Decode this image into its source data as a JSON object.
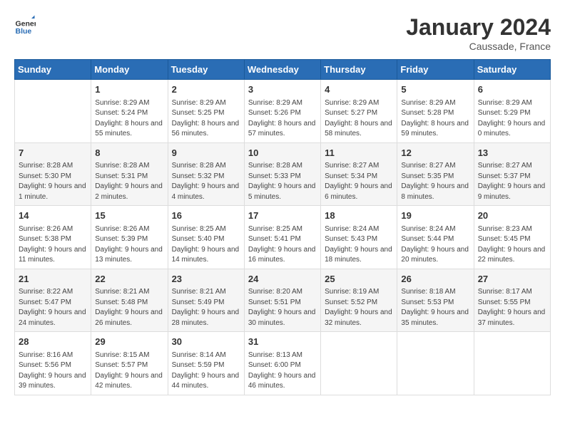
{
  "header": {
    "logo": {
      "general": "General",
      "blue": "Blue"
    },
    "title": "January 2024",
    "location": "Caussade, France"
  },
  "days_of_week": [
    "Sunday",
    "Monday",
    "Tuesday",
    "Wednesday",
    "Thursday",
    "Friday",
    "Saturday"
  ],
  "weeks": [
    [
      {
        "day": "",
        "sunrise": "",
        "sunset": "",
        "daylight": ""
      },
      {
        "day": "1",
        "sunrise": "Sunrise: 8:29 AM",
        "sunset": "Sunset: 5:24 PM",
        "daylight": "Daylight: 8 hours and 55 minutes."
      },
      {
        "day": "2",
        "sunrise": "Sunrise: 8:29 AM",
        "sunset": "Sunset: 5:25 PM",
        "daylight": "Daylight: 8 hours and 56 minutes."
      },
      {
        "day": "3",
        "sunrise": "Sunrise: 8:29 AM",
        "sunset": "Sunset: 5:26 PM",
        "daylight": "Daylight: 8 hours and 57 minutes."
      },
      {
        "day": "4",
        "sunrise": "Sunrise: 8:29 AM",
        "sunset": "Sunset: 5:27 PM",
        "daylight": "Daylight: 8 hours and 58 minutes."
      },
      {
        "day": "5",
        "sunrise": "Sunrise: 8:29 AM",
        "sunset": "Sunset: 5:28 PM",
        "daylight": "Daylight: 8 hours and 59 minutes."
      },
      {
        "day": "6",
        "sunrise": "Sunrise: 8:29 AM",
        "sunset": "Sunset: 5:29 PM",
        "daylight": "Daylight: 9 hours and 0 minutes."
      }
    ],
    [
      {
        "day": "7",
        "sunrise": "Sunrise: 8:28 AM",
        "sunset": "Sunset: 5:30 PM",
        "daylight": "Daylight: 9 hours and 1 minute."
      },
      {
        "day": "8",
        "sunrise": "Sunrise: 8:28 AM",
        "sunset": "Sunset: 5:31 PM",
        "daylight": "Daylight: 9 hours and 2 minutes."
      },
      {
        "day": "9",
        "sunrise": "Sunrise: 8:28 AM",
        "sunset": "Sunset: 5:32 PM",
        "daylight": "Daylight: 9 hours and 4 minutes."
      },
      {
        "day": "10",
        "sunrise": "Sunrise: 8:28 AM",
        "sunset": "Sunset: 5:33 PM",
        "daylight": "Daylight: 9 hours and 5 minutes."
      },
      {
        "day": "11",
        "sunrise": "Sunrise: 8:27 AM",
        "sunset": "Sunset: 5:34 PM",
        "daylight": "Daylight: 9 hours and 6 minutes."
      },
      {
        "day": "12",
        "sunrise": "Sunrise: 8:27 AM",
        "sunset": "Sunset: 5:35 PM",
        "daylight": "Daylight: 9 hours and 8 minutes."
      },
      {
        "day": "13",
        "sunrise": "Sunrise: 8:27 AM",
        "sunset": "Sunset: 5:37 PM",
        "daylight": "Daylight: 9 hours and 9 minutes."
      }
    ],
    [
      {
        "day": "14",
        "sunrise": "Sunrise: 8:26 AM",
        "sunset": "Sunset: 5:38 PM",
        "daylight": "Daylight: 9 hours and 11 minutes."
      },
      {
        "day": "15",
        "sunrise": "Sunrise: 8:26 AM",
        "sunset": "Sunset: 5:39 PM",
        "daylight": "Daylight: 9 hours and 13 minutes."
      },
      {
        "day": "16",
        "sunrise": "Sunrise: 8:25 AM",
        "sunset": "Sunset: 5:40 PM",
        "daylight": "Daylight: 9 hours and 14 minutes."
      },
      {
        "day": "17",
        "sunrise": "Sunrise: 8:25 AM",
        "sunset": "Sunset: 5:41 PM",
        "daylight": "Daylight: 9 hours and 16 minutes."
      },
      {
        "day": "18",
        "sunrise": "Sunrise: 8:24 AM",
        "sunset": "Sunset: 5:43 PM",
        "daylight": "Daylight: 9 hours and 18 minutes."
      },
      {
        "day": "19",
        "sunrise": "Sunrise: 8:24 AM",
        "sunset": "Sunset: 5:44 PM",
        "daylight": "Daylight: 9 hours and 20 minutes."
      },
      {
        "day": "20",
        "sunrise": "Sunrise: 8:23 AM",
        "sunset": "Sunset: 5:45 PM",
        "daylight": "Daylight: 9 hours and 22 minutes."
      }
    ],
    [
      {
        "day": "21",
        "sunrise": "Sunrise: 8:22 AM",
        "sunset": "Sunset: 5:47 PM",
        "daylight": "Daylight: 9 hours and 24 minutes."
      },
      {
        "day": "22",
        "sunrise": "Sunrise: 8:21 AM",
        "sunset": "Sunset: 5:48 PM",
        "daylight": "Daylight: 9 hours and 26 minutes."
      },
      {
        "day": "23",
        "sunrise": "Sunrise: 8:21 AM",
        "sunset": "Sunset: 5:49 PM",
        "daylight": "Daylight: 9 hours and 28 minutes."
      },
      {
        "day": "24",
        "sunrise": "Sunrise: 8:20 AM",
        "sunset": "Sunset: 5:51 PM",
        "daylight": "Daylight: 9 hours and 30 minutes."
      },
      {
        "day": "25",
        "sunrise": "Sunrise: 8:19 AM",
        "sunset": "Sunset: 5:52 PM",
        "daylight": "Daylight: 9 hours and 32 minutes."
      },
      {
        "day": "26",
        "sunrise": "Sunrise: 8:18 AM",
        "sunset": "Sunset: 5:53 PM",
        "daylight": "Daylight: 9 hours and 35 minutes."
      },
      {
        "day": "27",
        "sunrise": "Sunrise: 8:17 AM",
        "sunset": "Sunset: 5:55 PM",
        "daylight": "Daylight: 9 hours and 37 minutes."
      }
    ],
    [
      {
        "day": "28",
        "sunrise": "Sunrise: 8:16 AM",
        "sunset": "Sunset: 5:56 PM",
        "daylight": "Daylight: 9 hours and 39 minutes."
      },
      {
        "day": "29",
        "sunrise": "Sunrise: 8:15 AM",
        "sunset": "Sunset: 5:57 PM",
        "daylight": "Daylight: 9 hours and 42 minutes."
      },
      {
        "day": "30",
        "sunrise": "Sunrise: 8:14 AM",
        "sunset": "Sunset: 5:59 PM",
        "daylight": "Daylight: 9 hours and 44 minutes."
      },
      {
        "day": "31",
        "sunrise": "Sunrise: 8:13 AM",
        "sunset": "Sunset: 6:00 PM",
        "daylight": "Daylight: 9 hours and 46 minutes."
      },
      {
        "day": "",
        "sunrise": "",
        "sunset": "",
        "daylight": ""
      },
      {
        "day": "",
        "sunrise": "",
        "sunset": "",
        "daylight": ""
      },
      {
        "day": "",
        "sunrise": "",
        "sunset": "",
        "daylight": ""
      }
    ]
  ]
}
